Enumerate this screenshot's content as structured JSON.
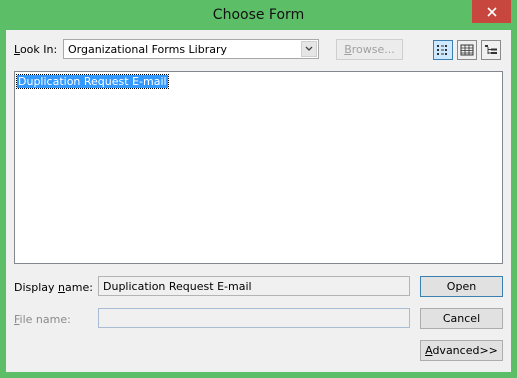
{
  "window": {
    "title": "Choose Form"
  },
  "look_in": {
    "label_access": "L",
    "label_rest": "ook In:",
    "value": "Organizational Forms Library"
  },
  "browse": {
    "access": "B",
    "rest": "rowse..."
  },
  "list": {
    "items": [
      "Duplication Request E-mail"
    ]
  },
  "display_name": {
    "label_pre": "Display ",
    "label_access": "n",
    "label_rest": "ame:",
    "value": "Duplication Request E-mail"
  },
  "file_name": {
    "label_access": "F",
    "label_rest": "ile name:",
    "value": ""
  },
  "buttons": {
    "open": "Open",
    "cancel": "Cancel",
    "advanced_access": "A",
    "advanced_rest": "dvanced>>"
  },
  "icons": {
    "close": "close-icon",
    "dropdown": "chevron-down-icon",
    "large_icons": "large-icons-view-icon",
    "list_view": "list-view-icon",
    "details_view": "details-view-icon"
  },
  "colors": {
    "frame": "#5cbf68",
    "close": "#c7463d",
    "selection": "#3399ff"
  }
}
